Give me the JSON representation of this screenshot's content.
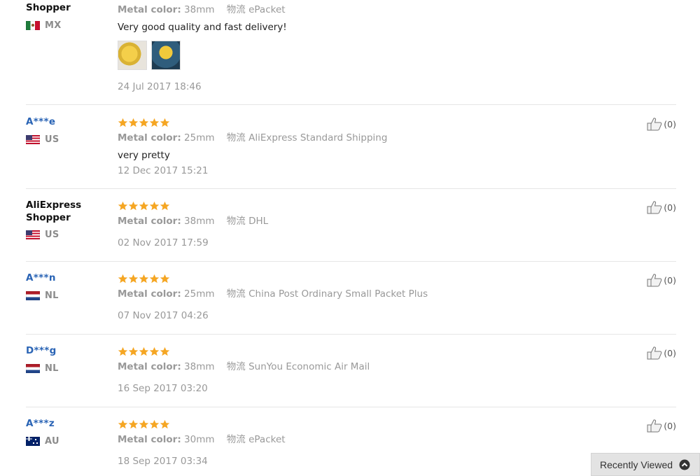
{
  "reviews": [
    {
      "buyer": "Shopper",
      "country_code": "MX",
      "flag": "mexico-flag-icon",
      "metal_color_label": "Metal color:",
      "metal_color": "38mm",
      "shipping_label": "物流",
      "shipping": "ePacket",
      "feedback": "Very good quality and fast delivery!",
      "date": "24 Jul 2017 18:46"
    },
    {
      "buyer": "A***e",
      "country_code": "US",
      "flag": "usa-flag-icon",
      "rating": 5,
      "metal_color_label": "Metal color:",
      "metal_color": "25mm",
      "shipping_label": "物流",
      "shipping": "AliExpress Standard Shipping",
      "feedback": "very pretty",
      "date": "12 Dec 2017 15:21",
      "helpful": "(0)"
    },
    {
      "buyer_line1": "AliExpress",
      "buyer_line2": "Shopper",
      "country_code": "US",
      "flag": "usa-flag-icon",
      "rating": 5,
      "metal_color_label": "Metal color:",
      "metal_color": "38mm",
      "shipping_label": "物流",
      "shipping": "DHL",
      "date": "02 Nov 2017 17:59",
      "helpful": "(0)"
    },
    {
      "buyer": "A***n",
      "country_code": "NL",
      "flag": "netherlands-flag-icon",
      "rating": 5,
      "metal_color_label": "Metal color:",
      "metal_color": "25mm",
      "shipping_label": "物流",
      "shipping": "China Post Ordinary Small Packet Plus",
      "date": "07 Nov 2017 04:26",
      "helpful": "(0)"
    },
    {
      "buyer": "D***g",
      "country_code": "NL",
      "flag": "netherlands-flag-icon",
      "rating": 5,
      "metal_color_label": "Metal color:",
      "metal_color": "38mm",
      "shipping_label": "物流",
      "shipping": "SunYou Economic Air Mail",
      "date": "16 Sep 2017 03:20",
      "helpful": "(0)"
    },
    {
      "buyer": "A***z",
      "country_code": "AU",
      "flag": "australia-flag-icon",
      "rating": 5,
      "metal_color_label": "Metal color:",
      "metal_color": "30mm",
      "shipping_label": "物流",
      "shipping": "ePacket",
      "date": "18 Sep 2017 03:34",
      "helpful": "(0)"
    }
  ],
  "recently_viewed": {
    "label": "Recently Viewed",
    "icon": "chevron-up-circle-icon"
  },
  "colors": {
    "star": "#f5a623",
    "masked_buyer": "#2a64b5",
    "muted_text": "#999999"
  }
}
